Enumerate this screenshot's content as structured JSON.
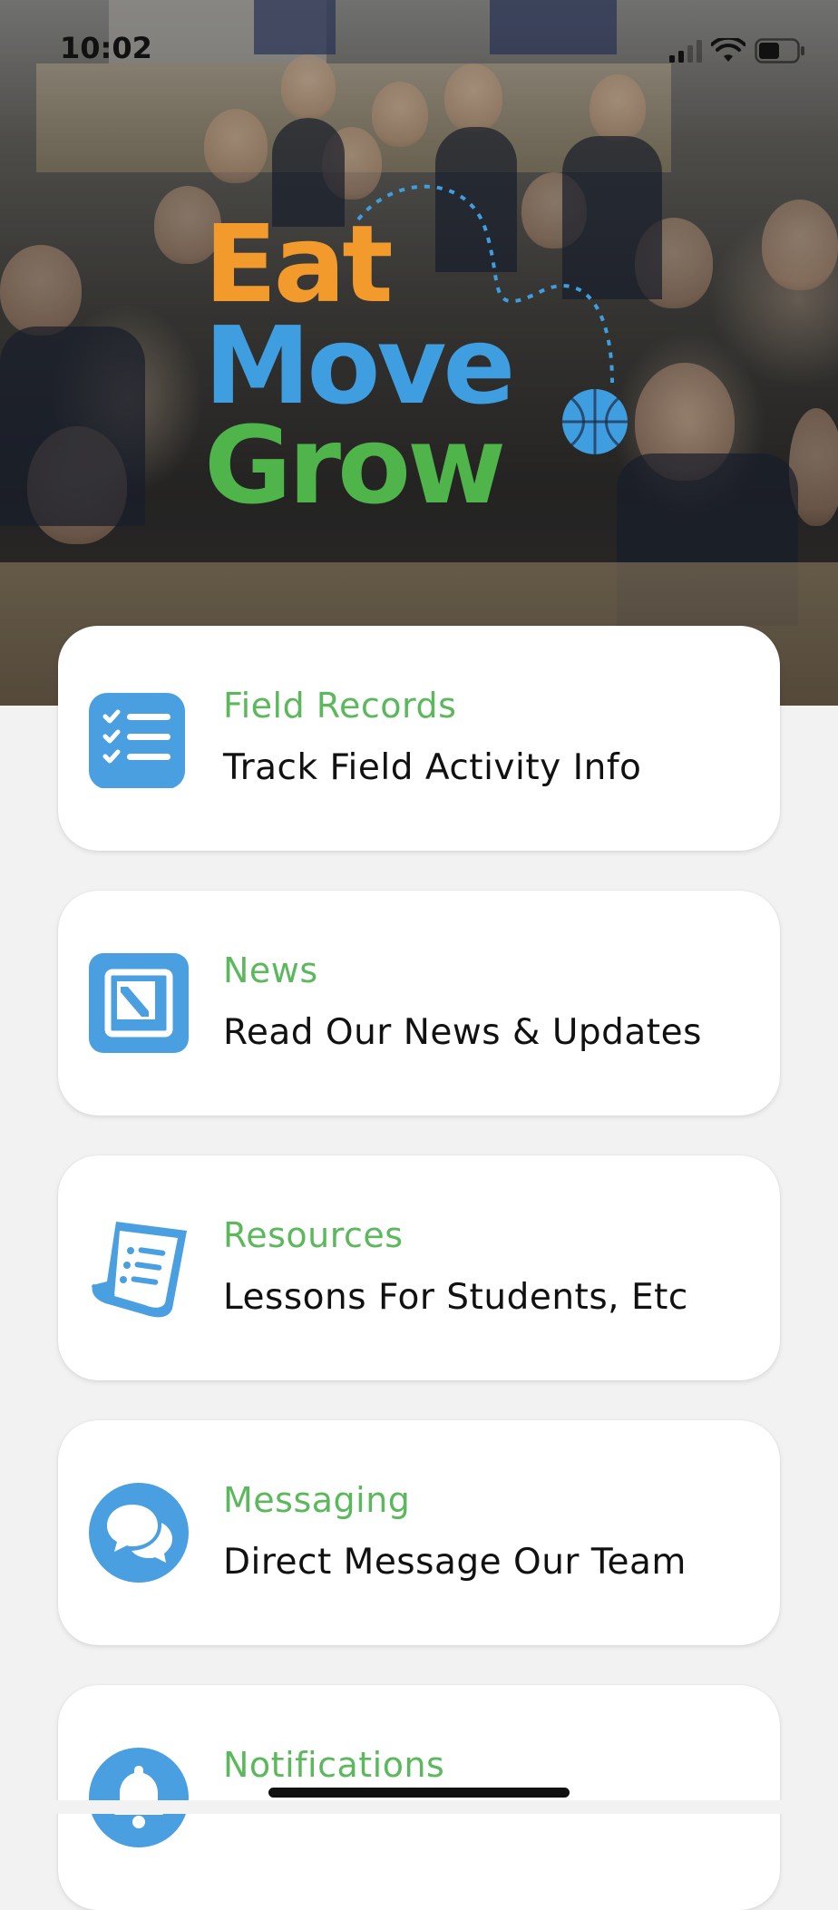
{
  "status_bar": {
    "time": "10:02",
    "signal_icon": "cellular-signal-icon",
    "wifi_icon": "wifi-icon",
    "battery_icon": "battery-icon"
  },
  "hero": {
    "logo": {
      "line1": "Eat",
      "line2": "Move",
      "line3": "Grow",
      "colors": {
        "eat": "#f39a2c",
        "move": "#3e9ee0",
        "grow": "#4fb54a"
      },
      "ball_icon": "basketball-icon"
    }
  },
  "menu": {
    "items": [
      {
        "title": "Field Records",
        "subtitle": "Track Field Activity Info",
        "icon": "checklist-icon"
      },
      {
        "title": "News",
        "subtitle": "Read Our News & Updates",
        "icon": "news-icon"
      },
      {
        "title": "Resources",
        "subtitle": "Lessons For Students, Etc",
        "icon": "document-scroll-icon"
      },
      {
        "title": "Messaging",
        "subtitle": "Direct Message Our Team",
        "icon": "chat-bubbles-icon"
      },
      {
        "title": "Notifications",
        "subtitle": "",
        "icon": "bell-icon"
      }
    ]
  },
  "colors": {
    "accent_blue": "#4a9fe0",
    "title_green": "#5cb85c",
    "background": "#f2f2f2"
  }
}
